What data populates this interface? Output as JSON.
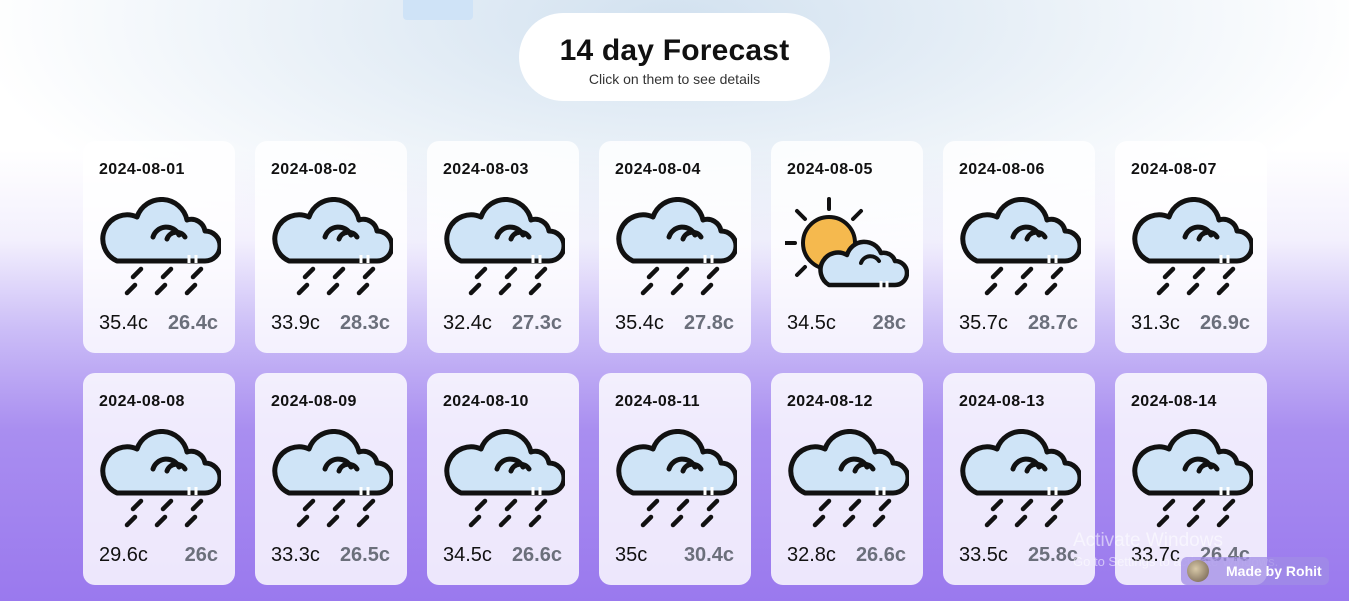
{
  "header": {
    "title": "14 day Forecast",
    "subtitle": "Click on them to see details"
  },
  "days": [
    {
      "date": "2024-08-01",
      "max": "35.4c",
      "min": "26.4c",
      "icon": "rain-cloud-icon"
    },
    {
      "date": "2024-08-02",
      "max": "33.9c",
      "min": "28.3c",
      "icon": "rain-cloud-icon"
    },
    {
      "date": "2024-08-03",
      "max": "32.4c",
      "min": "27.3c",
      "icon": "rain-cloud-icon"
    },
    {
      "date": "2024-08-04",
      "max": "35.4c",
      "min": "27.8c",
      "icon": "rain-cloud-icon"
    },
    {
      "date": "2024-08-05",
      "max": "34.5c",
      "min": "28c",
      "icon": "partly-cloudy-icon"
    },
    {
      "date": "2024-08-06",
      "max": "35.7c",
      "min": "28.7c",
      "icon": "rain-cloud-icon"
    },
    {
      "date": "2024-08-07",
      "max": "31.3c",
      "min": "26.9c",
      "icon": "rain-cloud-icon"
    },
    {
      "date": "2024-08-08",
      "max": "29.6c",
      "min": "26c",
      "icon": "rain-cloud-icon"
    },
    {
      "date": "2024-08-09",
      "max": "33.3c",
      "min": "26.5c",
      "icon": "rain-cloud-icon"
    },
    {
      "date": "2024-08-10",
      "max": "34.5c",
      "min": "26.6c",
      "icon": "rain-cloud-icon"
    },
    {
      "date": "2024-08-11",
      "max": "35c",
      "min": "30.4c",
      "icon": "rain-cloud-icon"
    },
    {
      "date": "2024-08-12",
      "max": "32.8c",
      "min": "26.6c",
      "icon": "rain-cloud-icon"
    },
    {
      "date": "2024-08-13",
      "max": "33.5c",
      "min": "25.8c",
      "icon": "rain-cloud-icon"
    },
    {
      "date": "2024-08-14",
      "max": "33.7c",
      "min": "26.4c",
      "icon": "rain-cloud-icon"
    }
  ],
  "watermark": {
    "title": "Activate Windows",
    "subtitle": "Go to Settings to activate Windows."
  },
  "badge": {
    "label": "Made by Rohit"
  },
  "colors": {
    "cloud_fill": "#cfe4f7",
    "sun_fill": "#f5b94e",
    "outline": "#111111",
    "min_temp": "#6b6f7b",
    "background_bottom": "#9a79ee"
  }
}
